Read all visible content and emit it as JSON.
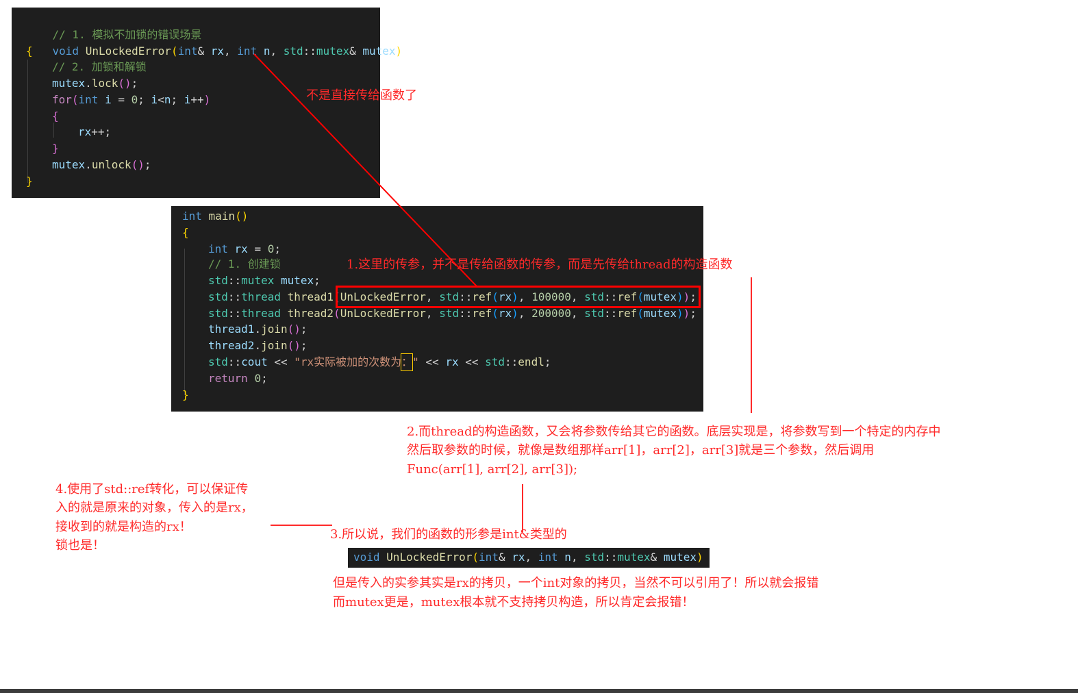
{
  "block1": {
    "lines": [
      "// 1. 模拟不加锁的错误场景",
      "void UnLockedError(int& rx, int n, std::mutex& mutex)",
      "{",
      "// 2. 加锁和解锁",
      "mutex.lock();",
      "for(int i = 0; i<n; i++)",
      "{",
      "rx++;",
      "}",
      "mutex.unlock();",
      "}"
    ]
  },
  "block2": {
    "lines": [
      "int main()",
      "{",
      "int rx = 0;",
      "// 1. 创建锁",
      "std::mutex mutex;",
      "std::thread thread1(UnLockedError, std::ref(rx), 100000, std::ref(mutex));",
      "std::thread thread2(UnLockedError, std::ref(rx), 200000, std::ref(mutex));",
      "thread1.join();",
      "thread2.join();",
      "std::cout << \"rx实际被加的次数为：\" << rx << std::endl;",
      "return 0;",
      "}"
    ]
  },
  "block3": {
    "line": "void UnLockedError(int& rx, int n, std::mutex& mutex)"
  },
  "annotations": {
    "note0": "不是直接传给函数了",
    "note1": "1.这里的传参，并不是传给函数的传参，而是先传给thread的构造函数",
    "note2": [
      "2.而thread的构造函数，又会将参数传给其它的函数。底层实现是，将参数写到一个特定的内存中",
      "然后取参数的时候，就像是数组那样arr[1]，arr[2]，arr[3]就是三个参数，然后调用",
      "Func(arr[1], arr[2], arr[3]);"
    ],
    "note3": "3.所以说，我们的函数的形参是int&类型的",
    "note4": [
      "4.使用了std::ref转化，可以保证传",
      "入的就是原来的对象，传入的是rx，",
      "接收到的就是构造的rx！",
      "锁也是！"
    ],
    "note5": [
      "但是传入的实参其实是rx的拷贝，一个int对象的拷贝，当然不可以引用了！所以就会报错",
      "而mutex更是，mutex根本就不支持拷贝构造，所以肯定会报错！"
    ]
  },
  "colors": {
    "editor_bg": "#1e1e1e",
    "keyword": "#569cd6",
    "function": "#dcdcaa",
    "variable": "#9cdcfe",
    "type": "#4ec9b0",
    "comment": "#6a9955",
    "number": "#b5cea8",
    "string": "#ce9178",
    "annotation": "#ff2a2a"
  }
}
